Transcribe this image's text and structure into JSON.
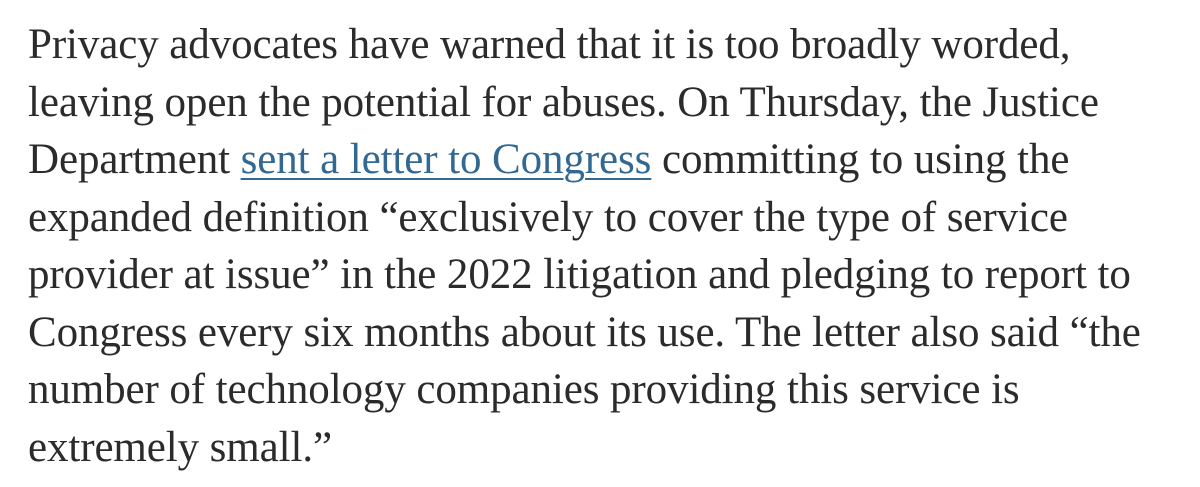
{
  "article": {
    "line_1": "Privacy advocates have warned that it is too broadly worded,",
    "line_2": "leaving open the potential for abuses. On Thursday, the Justice",
    "line_3_before_link": "Department ",
    "link_text": "sent a letter to Congress",
    "line_3_after_link": " committing to using the",
    "line_4": "expanded definition “exclusively to cover the type of service",
    "line_5": "provider at issue” in the 2022 litigation and pledging to report to",
    "line_6": "Congress every six months about its use. The letter also said “the",
    "line_7": "number of technology companies providing this service is",
    "line_8": "extremely small.”"
  },
  "colors": {
    "text": "#2b2b2b",
    "link": "#326891",
    "background": "#ffffff"
  }
}
